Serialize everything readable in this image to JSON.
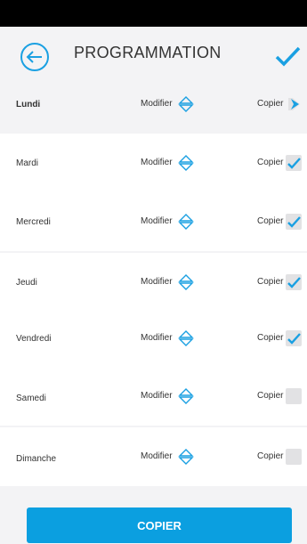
{
  "header": {
    "title": "PROGRAMMATION",
    "back_icon": "back-arrow-circle-icon",
    "confirm_icon": "checkmark-icon"
  },
  "days": [
    {
      "name": "Lundi",
      "modify_label": "Modifier",
      "copy_label": "Copier",
      "copy_state": "source"
    },
    {
      "name": "Mardi",
      "modify_label": "Modifier",
      "copy_label": "Copier",
      "copy_state": "checked"
    },
    {
      "name": "Mercredi",
      "modify_label": "Modifier",
      "copy_label": "Copier",
      "copy_state": "checked"
    },
    {
      "name": "Jeudi",
      "modify_label": "Modifier",
      "copy_label": "Copier",
      "copy_state": "checked"
    },
    {
      "name": "Vendredi",
      "modify_label": "Modifier",
      "copy_label": "Copier",
      "copy_state": "checked"
    },
    {
      "name": "Samedi",
      "modify_label": "Modifier",
      "copy_label": "Copier",
      "copy_state": "unchecked"
    },
    {
      "name": "Dimanche",
      "modify_label": "Modifier",
      "copy_label": "Copier",
      "copy_state": "unchecked"
    }
  ],
  "actions": {
    "copy_button": "COPIER"
  },
  "colors": {
    "accent": "#0b9fe0",
    "swatch": "#2c7fd0"
  }
}
